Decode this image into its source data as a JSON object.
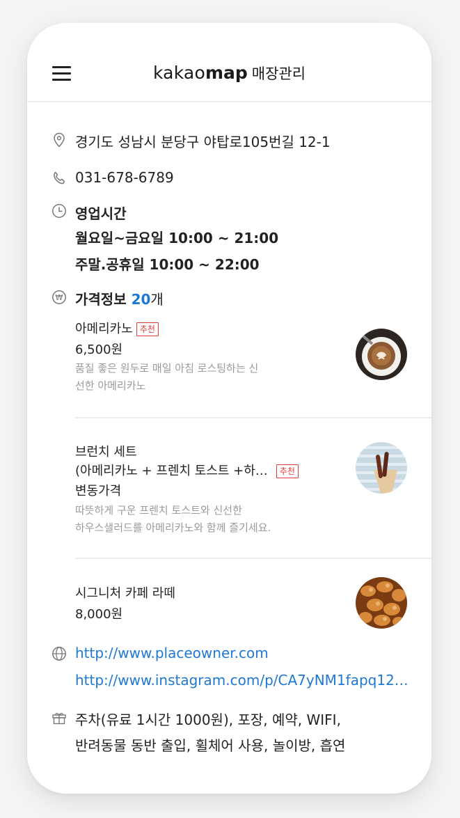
{
  "header": {
    "title_kakao": "kakao",
    "title_map": "map",
    "title_sub": "매장관리"
  },
  "info": {
    "address": "경기도 성남시 분당구 야탑로105번길 12-1",
    "phone": "031-678-6789",
    "hours_label": "영업시간",
    "hours": [
      "월요일~금요일 10:00 ~ 21:00",
      "주말.공휴일 10:00 ~ 22:00"
    ],
    "price_label": "가격정보",
    "price_count": "20",
    "price_unit": "개"
  },
  "menu_items": [
    {
      "name": "아메리카노",
      "badge": "추천",
      "price": "6,500원",
      "desc": [
        "품질 좋은 원두로 매일 아침 로스팅하는 신",
        "선한 아메리카노"
      ]
    },
    {
      "name_line1": "브런치 세트",
      "name_line2": "(아메리카노 + 프렌치 토스트 +하…",
      "badge": "추천",
      "price": "변동가격",
      "desc": [
        "따뜻하게 구운 프렌치 토스트와 신선한",
        "하우스샐러드를 아메리카노와 함께 즐기세요."
      ]
    },
    {
      "name": "시그니처 카페 라떼",
      "price": "8,000원"
    }
  ],
  "links": [
    "http://www.placeowner.com",
    "http://www.instagram.com/p/CA7yNM1fapq12…"
  ],
  "amenities": [
    "주차(유료 1시간 1000원), 포장, 예약, WIFI,",
    "반려동물 동반 출입, 휠체어 사용, 놀이방, 흡연"
  ],
  "icons": [
    "menu-icon",
    "location-pin-icon",
    "phone-icon",
    "clock-icon",
    "won-currency-icon",
    "globe-icon",
    "gift-box-icon"
  ],
  "colors": {
    "link": "#1f78d1",
    "badge": "#e23b3b",
    "muted": "#9a9a9a"
  }
}
